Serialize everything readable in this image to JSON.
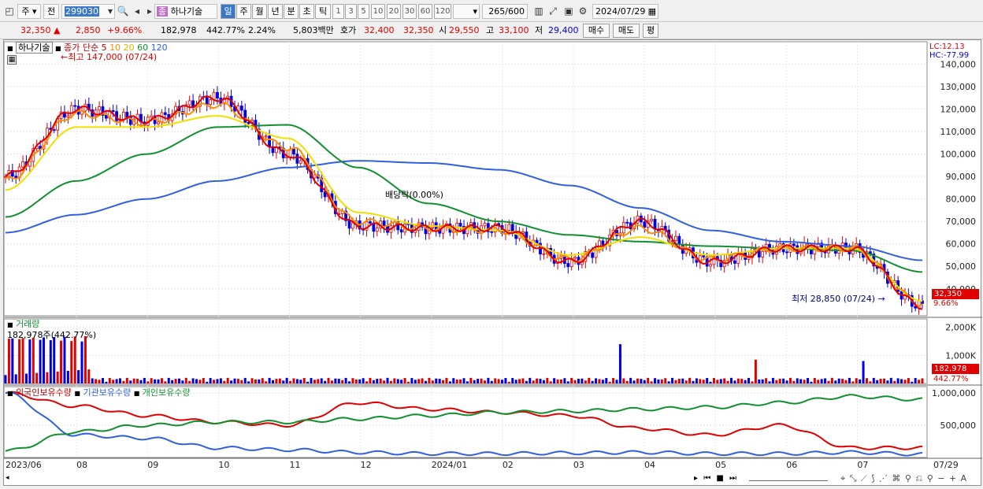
{
  "toolbar": {
    "period_type": "주",
    "prev": "전",
    "code": "299030",
    "stock_badge": "종",
    "stock_name": "하나기술",
    "periods": [
      "일",
      "주",
      "월",
      "년",
      "분",
      "초",
      "틱"
    ],
    "selected_period": "일",
    "intervals": [
      "1",
      "3",
      "5",
      "10",
      "20",
      "30",
      "60",
      "120"
    ],
    "count": "265",
    "count_total": "/600",
    "date": "2024/07/29"
  },
  "quote": {
    "price": "32,350",
    "change_arrow": "▲",
    "change": "2,850",
    "change_pct": "+9.66%",
    "volume": "182,978",
    "volume_ratio": "442.77%",
    "turnover_rate": "2.24%",
    "amount": "5,803백만",
    "bid_ask_label": "호가",
    "ask": "32,400",
    "bid": "32,350",
    "open_label": "시",
    "open": "29,550",
    "high_label": "고",
    "high": "33,100",
    "low_label": "저",
    "low": "29,400",
    "buy_label": "매수",
    "sell_label": "매도",
    "extra_label": "평"
  },
  "price_panel": {
    "stock_tag": "하나기술",
    "ma_label": "종가 단순",
    "ma_periods": [
      "5",
      "10",
      "20",
      "60",
      "120"
    ],
    "max_label": "최고 147,000 (07/24)",
    "min_label": "최저 28,850 (07/24)",
    "event_label": "배당락(0.00%)",
    "lc": "LC:12.13",
    "hc": "HC:-77.99",
    "current_price": "32,350",
    "current_pct": "9.66%",
    "y_ticks": [
      "140,000",
      "130,000",
      "120,000",
      "110,000",
      "100,000",
      "90,000",
      "80,000",
      "70,000",
      "60,000",
      "50,000",
      "40,000"
    ]
  },
  "volume_panel": {
    "title": "거래량",
    "value_label": "182,978주(442.77%)",
    "y_ticks": [
      "2,000K",
      "1,000K"
    ],
    "current": "182,978",
    "current_pct": "442.77%"
  },
  "holding_panel": {
    "series": [
      "외국인보유수량",
      "기관보유수량",
      "개인보유수량"
    ],
    "y_ticks": [
      "1,000,000",
      "500,000"
    ]
  },
  "x_axis": [
    "2023/06",
    "08",
    "09",
    "10",
    "11",
    "12",
    "2024/01",
    "02",
    "03",
    "04",
    "05",
    "06",
    "07",
    "07/29"
  ],
  "colors": {
    "up": "#e00000",
    "down": "#0000e0",
    "ma5": "#e00000",
    "ma10": "#ff8c00",
    "ma20": "#f0e000",
    "ma60": "#109030",
    "ma120": "#3060e0",
    "foreign": "#e00000",
    "institution": "#3060e0",
    "individual": "#109030"
  },
  "chart_data": {
    "type": "line",
    "x": [
      "2023/06",
      "2023/07",
      "2023/08",
      "2023/09",
      "2023/10",
      "2023/11",
      "2023/12",
      "2024/01",
      "2024/02",
      "2024/03",
      "2024/04",
      "2024/05",
      "2024/06",
      "2024/07/29"
    ],
    "series": [
      {
        "name": "5",
        "values": [
          90000,
          120000,
          115000,
          125000,
          100000,
          68000,
          67000,
          67000,
          52000,
          70000,
          52000,
          58000,
          58000,
          32350
        ]
      },
      {
        "name": "10",
        "values": [
          88000,
          118000,
          114000,
          122000,
          103000,
          70000,
          67000,
          66000,
          53000,
          67000,
          53000,
          58000,
          58000,
          33500
        ]
      },
      {
        "name": "20",
        "values": [
          84000,
          112000,
          112000,
          117000,
          107000,
          74000,
          68000,
          66000,
          55000,
          63000,
          55000,
          58000,
          58000,
          34500
        ]
      },
      {
        "name": "60",
        "values": [
          72000,
          88000,
          100000,
          112000,
          113000,
          94000,
          78000,
          70000,
          64000,
          61000,
          59000,
          58000,
          57000,
          47500
        ]
      },
      {
        "name": "120",
        "values": [
          65000,
          73000,
          80000,
          88000,
          94000,
          97000,
          96000,
          93000,
          86000,
          76000,
          66000,
          61000,
          59000,
          52700
        ]
      }
    ],
    "ylim": [
      28000,
      150000
    ]
  }
}
